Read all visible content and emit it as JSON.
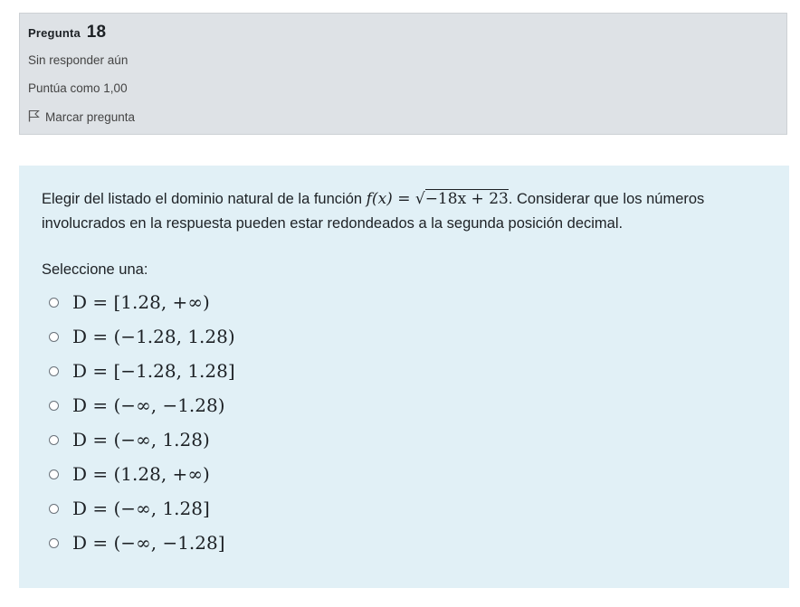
{
  "info": {
    "question_label": "Pregunta",
    "question_number": "18",
    "state": "Sin responder aún",
    "grade": "Puntúa como 1,00",
    "flag_label": "Marcar pregunta"
  },
  "question": {
    "text_before": "Elegir del listado el dominio natural de la función ",
    "function": "f(x) = ",
    "radicand": "−18x + 23",
    "text_after": ". Considerar que los números involucrados en la respuesta pueden estar redondeados a la segunda posición decimal.",
    "prompt": "Seleccione una:"
  },
  "options": [
    "D = [1.28, +∞)",
    "D = (−1.28, 1.28)",
    "D = [−1.28, 1.28]",
    "D = (−∞, −1.28)",
    "D = (−∞, 1.28)",
    "D = (1.28, +∞)",
    "D = (−∞, 1.28]",
    "D = (−∞, −1.28]"
  ],
  "colors": {
    "info_bg": "#dee2e6",
    "content_bg": "#e1f0f6"
  }
}
